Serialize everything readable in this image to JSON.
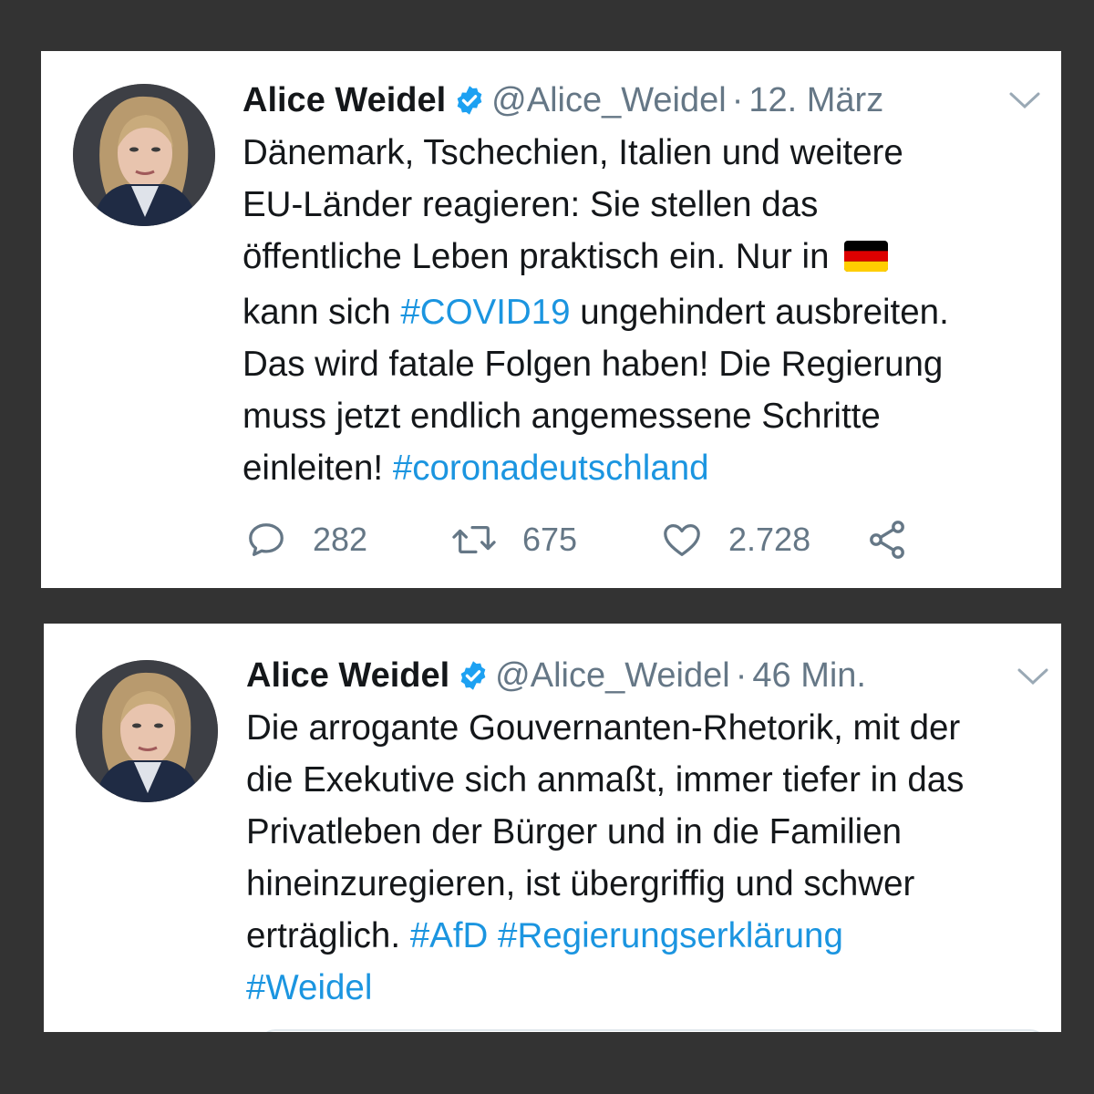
{
  "colors": {
    "background": "#333333",
    "card": "#ffffff",
    "link": "#1b95e0",
    "muted": "#657786",
    "verified": "#1da1f2"
  },
  "tweets": [
    {
      "author": "Alice Weidel",
      "handle": "@Alice_Weidel",
      "separator": "·",
      "time": "12. März",
      "verified_icon": "verified-badge-icon",
      "text": [
        {
          "t": "Dänemark, Tschechien, Italien und weitere\nEU-Länder reagieren: Sie stellen das\nöffentliche Leben praktisch ein. Nur in "
        },
        {
          "flag": "germany-flag-emoji"
        },
        {
          "t": "\nkann sich "
        },
        {
          "tag": "#COVID19"
        },
        {
          "t": " ungehindert ausbreiten.\nDas wird fatale Folgen haben! Die Regierung\nmuss jetzt endlich angemessene Schritte\neinleiten! "
        },
        {
          "tag": "#coronadeutschland"
        }
      ],
      "actions": {
        "replies": "282",
        "retweets": "675",
        "likes": "2.728"
      }
    },
    {
      "author": "Alice Weidel",
      "handle": "@Alice_Weidel",
      "separator": "·",
      "time": "46 Min.",
      "verified_icon": "verified-badge-icon",
      "text": [
        {
          "t": "Die arrogante Gouvernanten-Rhetorik, mit der\ndie Exekutive sich anmaßt, immer tiefer in das\nPrivatleben der Bürger und in die Familien\nhineinzuregieren, ist übergriffig und schwer\nerträglich. "
        },
        {
          "tag": "#AfD"
        },
        {
          "t": " "
        },
        {
          "tag": "#Regierungserklärung"
        },
        {
          "t": "\n"
        },
        {
          "tag": "#Weidel"
        }
      ]
    }
  ]
}
